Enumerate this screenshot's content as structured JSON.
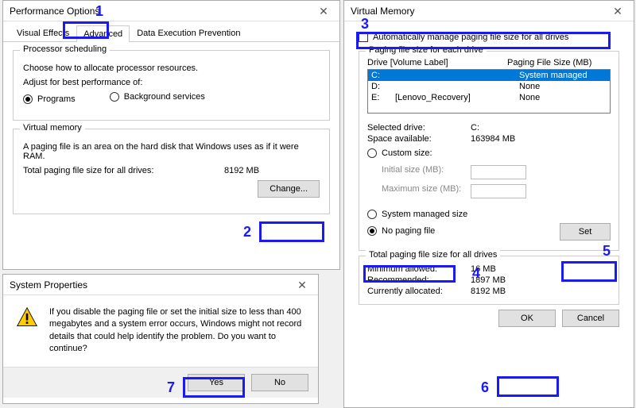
{
  "perf": {
    "title": "Performance Options",
    "tabs": [
      "Visual Effects",
      "Advanced",
      "Data Execution Prevention"
    ],
    "active_tab": 1,
    "sched": {
      "legend": "Processor scheduling",
      "desc": "Choose how to allocate processor resources.",
      "adjust": "Adjust for best performance of:",
      "programs": "Programs",
      "bgsvc": "Background services"
    },
    "vm": {
      "legend": "Virtual memory",
      "desc": "A paging file is an area on the hard disk that Windows uses as if it were RAM.",
      "total_label": "Total paging file size for all drives:",
      "total_value": "8192 MB",
      "change": "Change..."
    }
  },
  "sysprop": {
    "title": "System Properties",
    "msg": "If you disable the paging file or set the initial size to less than 400 megabytes and a system error occurs, Windows might not record details that could help identify the problem. Do you want to continue?",
    "yes": "Yes",
    "no": "No"
  },
  "vmem": {
    "title": "Virtual Memory",
    "auto": "Automatically manage paging file size for all drives",
    "group_legend": "Paging file size for each drive",
    "hdr_drive": "Drive  [Volume Label]",
    "hdr_size": "Paging File Size (MB)",
    "drives": [
      {
        "letter": "C:",
        "label": "",
        "size": "System managed",
        "sel": true
      },
      {
        "letter": "D:",
        "label": "",
        "size": "None",
        "sel": false
      },
      {
        "letter": "E:",
        "label": "[Lenovo_Recovery]",
        "size": "None",
        "sel": false
      }
    ],
    "sel_drive_l": "Selected drive:",
    "sel_drive_v": "C:",
    "space_l": "Space available:",
    "space_v": "163984 MB",
    "custom": "Custom size:",
    "init_l": "Initial size (MB):",
    "max_l": "Maximum size (MB):",
    "sysman": "System managed size",
    "nopf": "No paging file",
    "set": "Set",
    "totals_legend": "Total paging file size for all drives",
    "min_l": "Minimum allowed:",
    "min_v": "16 MB",
    "rec_l": "Recommended:",
    "rec_v": "1897 MB",
    "cur_l": "Currently allocated:",
    "cur_v": "8192 MB",
    "ok": "OK",
    "cancel": "Cancel"
  },
  "annotations": {
    "n1": "1",
    "n2": "2",
    "n3": "3",
    "n4": "4",
    "n5": "5",
    "n6": "6",
    "n7": "7"
  }
}
